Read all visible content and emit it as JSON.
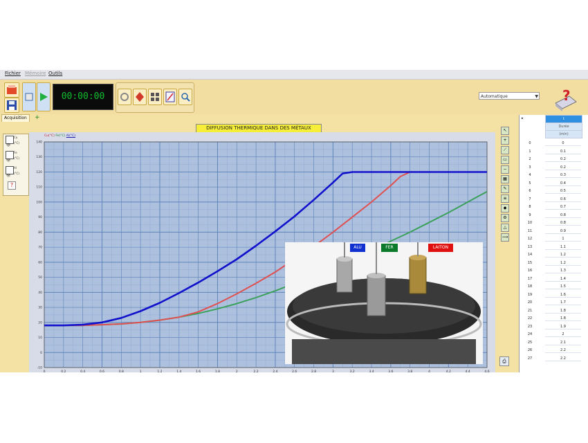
{
  "menu": {
    "items": [
      "Fichier",
      "Mémoire",
      "Outils"
    ]
  },
  "toolbar": {
    "timer": "00:00:00",
    "mode_select": "Automatique"
  },
  "tabs": {
    "acquisition": "Acquisition",
    "add": "+"
  },
  "series_panel": {
    "items": [
      {
        "name": "Cu",
        "unit": "(°C)"
      },
      {
        "name": "Fe",
        "unit": "(°C)"
      },
      {
        "name": "Al",
        "unit": "(°C)"
      }
    ],
    "help": "?"
  },
  "chart": {
    "title": "DIFFUSION THERMIQUE  DANS DES MÉTAUX",
    "legend": [
      "Cu(°C)",
      "Fe(°C)",
      "Al(°C)"
    ]
  },
  "chart_data": {
    "type": "line",
    "xlim": [
      0,
      4.6
    ],
    "ylim": [
      -10,
      140
    ],
    "yticks": [
      -10,
      0,
      10,
      20,
      30,
      40,
      50,
      60,
      70,
      80,
      90,
      100,
      110,
      120,
      130,
      140
    ],
    "ytick_labels": [
      "-10",
      "0",
      "10",
      "20",
      "30",
      "40",
      "50",
      "60",
      "70",
      "80",
      "90",
      "100",
      "110",
      "120",
      "130",
      "140"
    ],
    "xticks": [
      0,
      0.2,
      0.4,
      0.6,
      0.8,
      1,
      1.2,
      1.4,
      1.6,
      1.8,
      2,
      2.2,
      2.4,
      2.6,
      2.8,
      3,
      3.2,
      3.4,
      3.6,
      3.8,
      4,
      4.2,
      4.4,
      4.6
    ],
    "xtick_labels": [
      "0",
      "0.2",
      "0.4",
      "0.6",
      "0.8",
      "1",
      "1.2",
      "1.4",
      "1.6",
      "1.8",
      "2",
      "2.2",
      "2.4",
      "2.6",
      "2.8",
      "3",
      "3.2",
      "3.4",
      "3.6",
      "3.8",
      "4",
      "4.2",
      "4.4",
      "4.6"
    ],
    "grid": true,
    "series": [
      {
        "name": "Al(°C)",
        "color": "#1111cc",
        "x": [
          0,
          0.2,
          0.4,
          0.6,
          0.8,
          1.0,
          1.2,
          1.4,
          1.6,
          1.8,
          2.0,
          2.2,
          2.4,
          2.6,
          2.8,
          3.0,
          3.1,
          3.2,
          3.4,
          3.6,
          3.8,
          4.0,
          4.2,
          4.4,
          4.6
        ],
        "y": [
          18,
          18,
          18.5,
          20,
          23,
          27.5,
          33,
          39.5,
          46.5,
          54,
          62,
          71,
          80.5,
          90.5,
          101.5,
          113,
          119,
          120,
          120,
          120,
          120,
          120,
          120,
          120,
          120
        ]
      },
      {
        "name": "Fe(°C)",
        "color": "#e05050",
        "x": [
          0,
          0.2,
          0.4,
          0.6,
          0.8,
          1.0,
          1.2,
          1.4,
          1.6,
          1.8,
          2.0,
          2.2,
          2.4,
          2.6,
          2.8,
          3.0,
          3.2,
          3.4,
          3.6,
          3.7,
          3.8,
          4.0,
          4.2,
          4.4,
          4.6
        ],
        "y": [
          18,
          18,
          18,
          18.5,
          19,
          20,
          21.5,
          23.5,
          27,
          32.5,
          39,
          46,
          53.5,
          62,
          70.5,
          80,
          90,
          100,
          111,
          117,
          120,
          120,
          120,
          120,
          120
        ]
      },
      {
        "name": "Cu(°C)",
        "color": "#3aa05a",
        "x": [
          0,
          0.2,
          0.4,
          0.6,
          0.8,
          1.0,
          1.2,
          1.4,
          1.6,
          1.8,
          2.0,
          2.2,
          2.4,
          2.6,
          2.8,
          3.0,
          3.2,
          3.4,
          3.6,
          3.8,
          4.0,
          4.2,
          4.4,
          4.6
        ],
        "y": [
          18,
          18,
          18,
          18.5,
          19,
          20,
          21.5,
          23.5,
          26,
          29,
          32.5,
          36.5,
          41,
          46,
          51,
          56.5,
          62,
          68,
          74,
          80,
          86.5,
          93,
          100,
          107
        ]
      }
    ]
  },
  "photo": {
    "labels": [
      {
        "text": "ALU",
        "bg": "#1030d0"
      },
      {
        "text": "FER",
        "bg": "#0a7a2a"
      },
      {
        "text": "LAITON",
        "bg": "#e01010"
      }
    ]
  },
  "data_table": {
    "header": [
      "t",
      "Durée",
      "(min)"
    ],
    "rows": [
      [
        "0",
        "0"
      ],
      [
        "1",
        "0.1"
      ],
      [
        "2",
        "0.2"
      ],
      [
        "3",
        "0.2"
      ],
      [
        "4",
        "0.3"
      ],
      [
        "5",
        "0.4"
      ],
      [
        "6",
        "0.5"
      ],
      [
        "7",
        "0.6"
      ],
      [
        "8",
        "0.7"
      ],
      [
        "9",
        "0.8"
      ],
      [
        "10",
        "0.8"
      ],
      [
        "11",
        "0.9"
      ],
      [
        "12",
        "1"
      ],
      [
        "13",
        "1.1"
      ],
      [
        "14",
        "1.2"
      ],
      [
        "15",
        "1.2"
      ],
      [
        "16",
        "1.3"
      ],
      [
        "17",
        "1.4"
      ],
      [
        "18",
        "1.5"
      ],
      [
        "19",
        "1.6"
      ],
      [
        "20",
        "1.7"
      ],
      [
        "21",
        "1.8"
      ],
      [
        "22",
        "1.8"
      ],
      [
        "23",
        "1.9"
      ],
      [
        "24",
        "2"
      ],
      [
        "25",
        "2.1"
      ],
      [
        "26",
        "2.2"
      ],
      [
        "27",
        "2.2"
      ]
    ]
  },
  "colors": {
    "app_bg": "#f3e2a3",
    "plot_bg": "#adc1df",
    "grid": "#5f84b8"
  }
}
